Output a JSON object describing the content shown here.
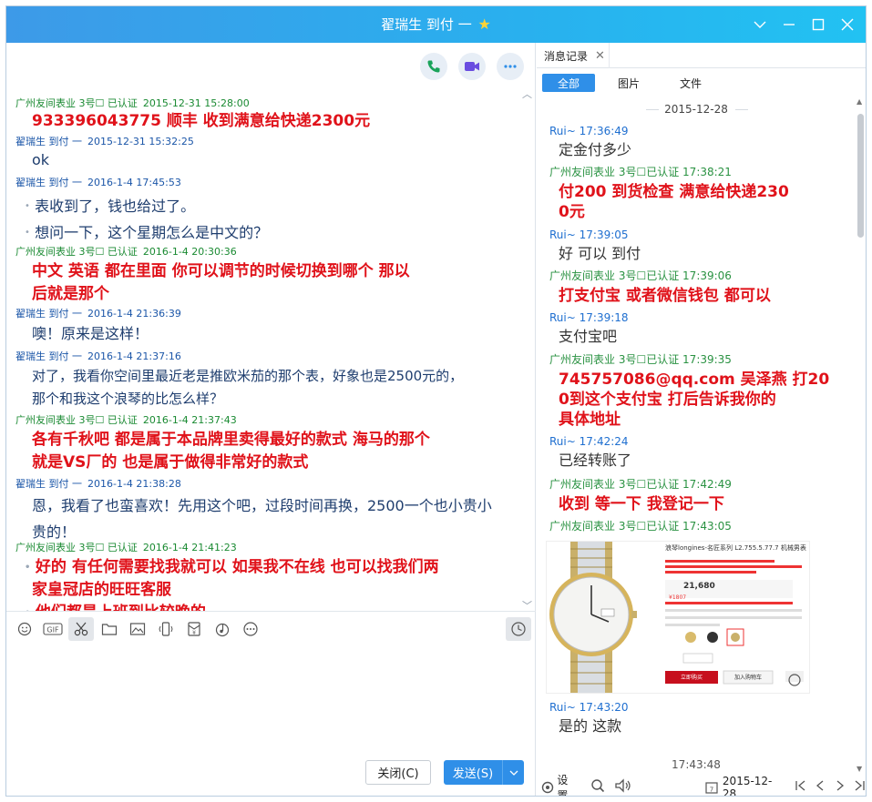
{
  "window": {
    "title": "翟瑞生 到付 一"
  },
  "colors": {
    "titlebar": "#2aa8ee",
    "accent": "#2f8fe8",
    "seller_name": "#1a8a32",
    "buyer_name": "#1b56a8",
    "seller_text": "#e0121a"
  },
  "chat": {
    "messages": [
      {
        "sender": "广州友间表业 3号☐ 已认证",
        "time": "2015-12-31 15:28:00",
        "role": "seller",
        "lines": [
          "933396043775  顺丰  收到满意给快递2300元"
        ]
      },
      {
        "sender": "翟瑞生 到付 一",
        "time": "2015-12-31 15:32:25",
        "role": "buyer",
        "lines": [
          "ok"
        ]
      },
      {
        "sender": "翟瑞生 到付 一",
        "time": "2016-1-4 17:45:53",
        "role": "buyer",
        "lines": [
          "表收到了，钱也给过了。",
          "想问一下，这个星期怎么是中文的？"
        ]
      },
      {
        "sender": "广州友间表业 3号☐ 已认证",
        "time": "2016-1-4 20:30:36",
        "role": "seller",
        "lines": [
          "中文  英语  都在里面    你可以调节的时候切换到哪个    那以",
          "后就是那个"
        ]
      },
      {
        "sender": "翟瑞生 到付 一",
        "time": "2016-1-4 21:36:39",
        "role": "buyer",
        "lines": [
          "噢！原来是这样！"
        ]
      },
      {
        "sender": "翟瑞生 到付 一",
        "time": "2016-1-4 21:37:16",
        "role": "buyer",
        "lines": [
          "对了，我看你空间里最近老是推欧米茄的那个表，好象也是2500元的，",
          "那个和我这个浪琴的比怎么样？"
        ]
      },
      {
        "sender": "广州友间表业 3号☐ 已认证",
        "time": "2016-1-4 21:37:43",
        "role": "seller",
        "lines": [
          "各有千秋吧  都是属于本品牌里卖得最好的款式    海马的那个",
          "就是VS厂的  也是属于做得非常好的款式"
        ]
      },
      {
        "sender": "翟瑞生 到付 一",
        "time": "2016-1-4 21:38:28",
        "role": "buyer",
        "lines": [
          "恩，我看了也蛮喜欢！先用这个吧，过段时间再换，2500一个也小贵小",
          "贵的！"
        ]
      },
      {
        "sender": "广州友间表业 3号☐ 已认证",
        "time": "2016-1-4 21:41:23",
        "role": "seller",
        "lines": [
          "好的  有任何需要找我就可以  如果我不在线  也可以找我们两",
          "家皇冠店的旺旺客服",
          "他们都是上班到比较晚的"
        ]
      }
    ]
  },
  "buttons": {
    "close": "关闭(C)",
    "send": "发送(S)"
  },
  "history": {
    "tab": "消息记录",
    "filters": [
      "全部",
      "图片",
      "文件"
    ],
    "date": "2015-12-28",
    "messages": [
      {
        "sender": "Rui~",
        "time": "17:36:49",
        "role": "buyer",
        "lines": [
          "定金付多少"
        ]
      },
      {
        "sender": "广州友间表业 3号☐已认证",
        "time": "17:38:21",
        "role": "seller",
        "lines": [
          "付200    到货检查  满意给快递230",
          "0元"
        ]
      },
      {
        "sender": "Rui~",
        "time": "17:39:05",
        "role": "buyer",
        "lines": [
          "好 可以 到付"
        ]
      },
      {
        "sender": "广州友间表业 3号☐已认证",
        "time": "17:39:06",
        "role": "seller",
        "lines": [
          "打支付宝  或者微信钱包  都可以"
        ]
      },
      {
        "sender": "Rui~",
        "time": "17:39:18",
        "role": "buyer",
        "lines": [
          "支付宝吧"
        ]
      },
      {
        "sender": "广州友间表业 3号☐已认证",
        "time": "17:39:35",
        "role": "seller",
        "lines": [
          "745757086@qq.com 吴泽燕  打20",
          "0到这个支付宝  打后告诉我你的",
          "具体地址"
        ]
      },
      {
        "sender": "Rui~",
        "time": "17:42:24",
        "role": "buyer",
        "lines": [
          "已经转账了"
        ]
      },
      {
        "sender": "广州友间表业 3号☐已认证",
        "time": "17:42:49",
        "role": "seller",
        "lines": [
          "收到  等一下  我登记一下"
        ]
      },
      {
        "sender": "广州友间表业 3号☐已认证",
        "time": "17:43:05",
        "role": "seller",
        "lines": []
      },
      {
        "sender": "Rui~",
        "time": "17:43:20",
        "role": "buyer",
        "lines": [
          "是的 这款"
        ]
      }
    ],
    "product": {
      "title": "浪琴longines-名匠系列",
      "model": "L2.755.5.77.7",
      "type": "机械男表",
      "price": "21,680",
      "price2": "¥1807",
      "buy": "立即购买",
      "cart": "加入购物车"
    },
    "footer_time": "17:43:48",
    "bottom": {
      "settings": "设置",
      "date": "2015-12-28"
    }
  }
}
